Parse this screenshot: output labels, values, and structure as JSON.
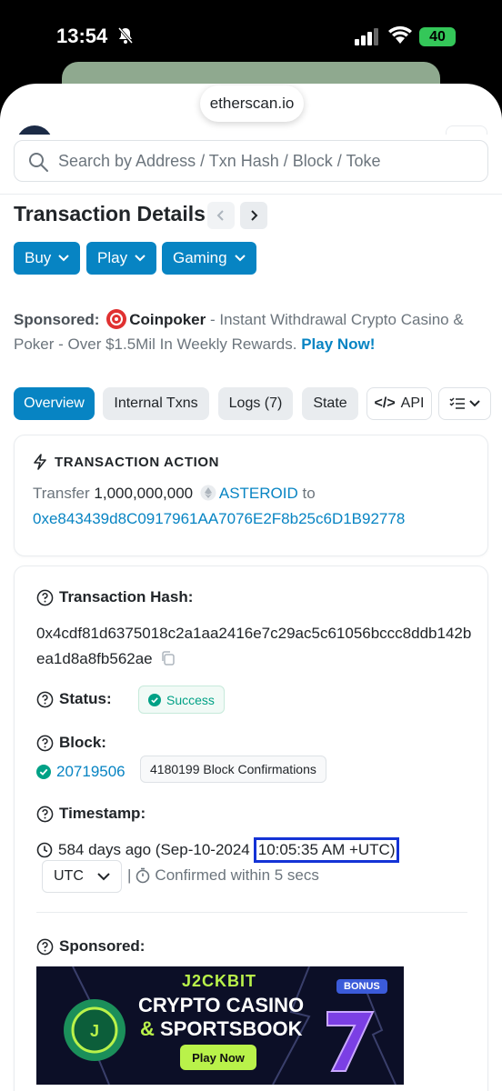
{
  "status_bar": {
    "time": "13:54",
    "battery": "40"
  },
  "browser": {
    "url": "etherscan.io"
  },
  "search": {
    "placeholder": "Search by Address / Txn Hash / Block / Toke"
  },
  "page": {
    "title": "Transaction Details"
  },
  "action_buttons": [
    {
      "label": "Buy"
    },
    {
      "label": "Play"
    },
    {
      "label": "Gaming"
    }
  ],
  "sponsor_line": {
    "prefix": "Sponsored:",
    "name": "Coinpoker",
    "text": " - Instant Withdrawal Crypto Casino & Poker - Over $1.5Mil In Weekly Rewards. ",
    "cta": "Play Now!"
  },
  "tabs": [
    {
      "label": "Overview"
    },
    {
      "label": "Internal Txns"
    },
    {
      "label": "Logs (7)"
    },
    {
      "label": "State"
    },
    {
      "label": "API"
    }
  ],
  "transaction_action": {
    "heading": "TRANSACTION ACTION",
    "verb": "Transfer",
    "amount": "1,000,000,000",
    "token": "ASTEROID",
    "to_word": "to",
    "to_address": "0xe843439d8C0917961AA7076E2F8b25c6D1B92778"
  },
  "details": {
    "hash_label": "Transaction Hash:",
    "hash": "0x4cdf81d6375018c2a1aa2416e7c29ac5c61056bccc8ddb142bea1d8a8fb562ae",
    "status_label": "Status:",
    "status": "Success",
    "block_label": "Block:",
    "block": "20719506",
    "confirmations": "4180199 Block Confirmations",
    "timestamp_label": "Timestamp:",
    "timestamp_prefix": "584 days ago (Sep-10-2024",
    "timestamp_time": "10:05:35 AM +UTC)",
    "timezone": "UTC",
    "separator": "|",
    "confirmed_within": "Confirmed within 5 secs",
    "sponsored_label": "Sponsored:"
  },
  "ad_banner": {
    "logo": "J2CKBIT",
    "line1": "CRYPTO CASINO",
    "line2_amp": "&",
    "line2": "SPORTSBOOK",
    "button": "Play Now",
    "badge": "BONUS"
  },
  "colors": {
    "primary": "#0784c3",
    "success": "#00a186",
    "highlight_box": "#1433d6"
  }
}
